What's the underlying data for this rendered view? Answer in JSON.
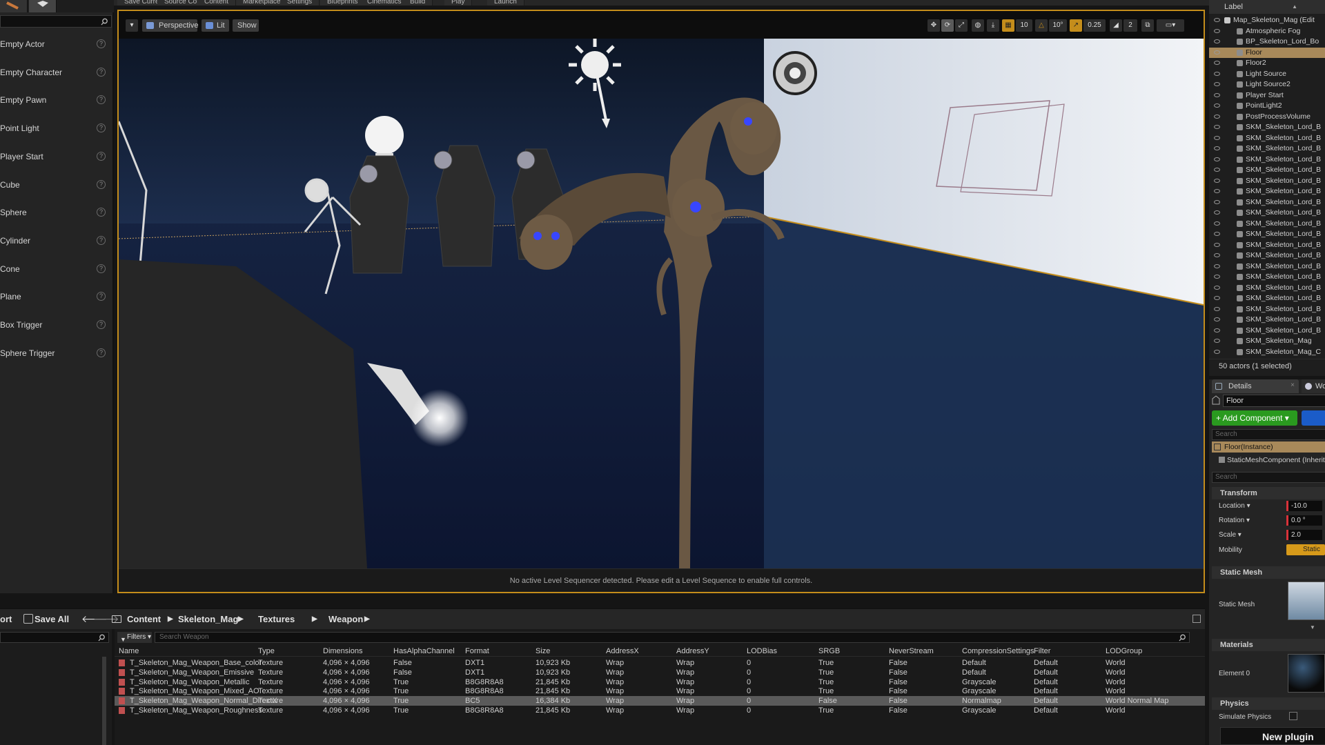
{
  "topbar": {
    "items": [
      "Save Current",
      "Source Control",
      "Content",
      "Marketplace",
      "Settings",
      "Blueprints",
      "Cinematics",
      "Build",
      "Play",
      "Launch"
    ]
  },
  "place_panel": {
    "items": [
      "Empty Actor",
      "Empty Character",
      "Empty Pawn",
      "Point Light",
      "Player Start",
      "Cube",
      "Sphere",
      "Cylinder",
      "Cone",
      "Plane",
      "Box Trigger",
      "Sphere Trigger"
    ],
    "help_glyph": "?"
  },
  "viewport": {
    "perspective_label": "Perspective",
    "lit_label": "Lit",
    "show_label": "Show",
    "grid_snap": "10",
    "rotation_snap": "10°",
    "scale_snap": "0.25",
    "camera_speed": "2",
    "status_message": "No active Level Sequencer detected. Please edit a Level Sequence to enable full controls."
  },
  "outliner": {
    "column_label": "Label",
    "items": [
      "Map_Skeleton_Mag (Edit",
      "Atmospheric Fog",
      "BP_Skeleton_Lord_Bo",
      "Floor",
      "Floor2",
      "Light Source",
      "Light Source2",
      "Player Start",
      "PointLight2",
      "PostProcessVolume",
      "SKM_Skeleton_Lord_B",
      "SKM_Skeleton_Lord_B",
      "SKM_Skeleton_Lord_B",
      "SKM_Skeleton_Lord_B",
      "SKM_Skeleton_Lord_B",
      "SKM_Skeleton_Lord_B",
      "SKM_Skeleton_Lord_B",
      "SKM_Skeleton_Lord_B",
      "SKM_Skeleton_Lord_B",
      "SKM_Skeleton_Lord_B",
      "SKM_Skeleton_Lord_B",
      "SKM_Skeleton_Lord_B",
      "SKM_Skeleton_Lord_B",
      "SKM_Skeleton_Lord_B",
      "SKM_Skeleton_Lord_B",
      "SKM_Skeleton_Lord_B",
      "SKM_Skeleton_Lord_B",
      "SKM_Skeleton_Lord_B",
      "SKM_Skeleton_Lord_B",
      "SKM_Skeleton_Lord_B",
      "SKM_Skeleton_Mag",
      "SKM_Skeleton_Mag_C"
    ],
    "selected": "Floor",
    "count": "50 actors (1 selected)"
  },
  "details": {
    "tab_label": "Details",
    "tab2_label": "Wo",
    "object_name": "Floor",
    "add_component": "+ Add Component ▾",
    "search_placeholder": "Search",
    "instance_label": "Floor(Instance)",
    "component_label": "StaticMeshComponent (Inherit",
    "search2_placeholder": "Search",
    "transform_header": "Transform",
    "location_label": "Location ▾",
    "location_value": "-10.0",
    "rotation_label": "Rotation ▾",
    "rotation_value": "0.0 °",
    "scale_label": "Scale ▾",
    "scale_value": "2.0",
    "mobility_label": "Mobility",
    "mobility_value": "Static",
    "static_mesh_header": "Static Mesh",
    "static_mesh_label": "Static Mesh",
    "materials_header": "Materials",
    "element_label": "Element 0",
    "physics_header": "Physics",
    "simulate_label": "Simulate Physics",
    "plugin_toast": "New plugin"
  },
  "content_browser": {
    "import_label": "ort",
    "save_all_label": "Save All",
    "breadcrumbs": [
      "Content",
      "Skeleton_Mag",
      "Textures",
      "Weapon"
    ],
    "filters_label": "Filters ▾",
    "search_placeholder": "Search Weapon",
    "columns": [
      "Name",
      "Type",
      "Dimensions",
      "HasAlphaChannel",
      "Format",
      "Size",
      "AddressX",
      "AddressY",
      "LODBias",
      "SRGB",
      "NeverStream",
      "CompressionSettings",
      "Filter",
      "LODGroup"
    ],
    "rows": [
      [
        "T_Skeleton_Mag_Weapon_Base_color",
        "Texture",
        "4,096 × 4,096",
        "False",
        "DXT1",
        "10,923 Kb",
        "Wrap",
        "Wrap",
        "0",
        "True",
        "False",
        "Default",
        "Default",
        "World"
      ],
      [
        "T_Skeleton_Mag_Weapon_Emissive",
        "Texture",
        "4,096 × 4,096",
        "False",
        "DXT1",
        "10,923 Kb",
        "Wrap",
        "Wrap",
        "0",
        "True",
        "False",
        "Default",
        "Default",
        "World"
      ],
      [
        "T_Skeleton_Mag_Weapon_Metallic",
        "Texture",
        "4,096 × 4,096",
        "True",
        "B8G8R8A8",
        "21,845 Kb",
        "Wrap",
        "Wrap",
        "0",
        "True",
        "False",
        "Grayscale",
        "Default",
        "World"
      ],
      [
        "T_Skeleton_Mag_Weapon_Mixed_AO",
        "Texture",
        "4,096 × 4,096",
        "True",
        "B8G8R8A8",
        "21,845 Kb",
        "Wrap",
        "Wrap",
        "0",
        "True",
        "False",
        "Grayscale",
        "Default",
        "World"
      ],
      [
        "T_Skeleton_Mag_Weapon_Normal_DirectX",
        "Texture",
        "4,096 × 4,096",
        "True",
        "BC5",
        "16,384 Kb",
        "Wrap",
        "Wrap",
        "0",
        "False",
        "False",
        "Normalmap",
        "Default",
        "World Normal Map"
      ],
      [
        "T_Skeleton_Mag_Weapon_Roughness",
        "Texture",
        "4,096 × 4,096",
        "True",
        "B8G8R8A8",
        "21,845 Kb",
        "Wrap",
        "Wrap",
        "0",
        "True",
        "False",
        "Grayscale",
        "Default",
        "World"
      ]
    ],
    "selected_row": 4
  },
  "colors": {
    "accent": "#c48d1b",
    "selection": "#a8895a",
    "add_component": "#2a9a1f",
    "mobility": "#d79a1a"
  }
}
